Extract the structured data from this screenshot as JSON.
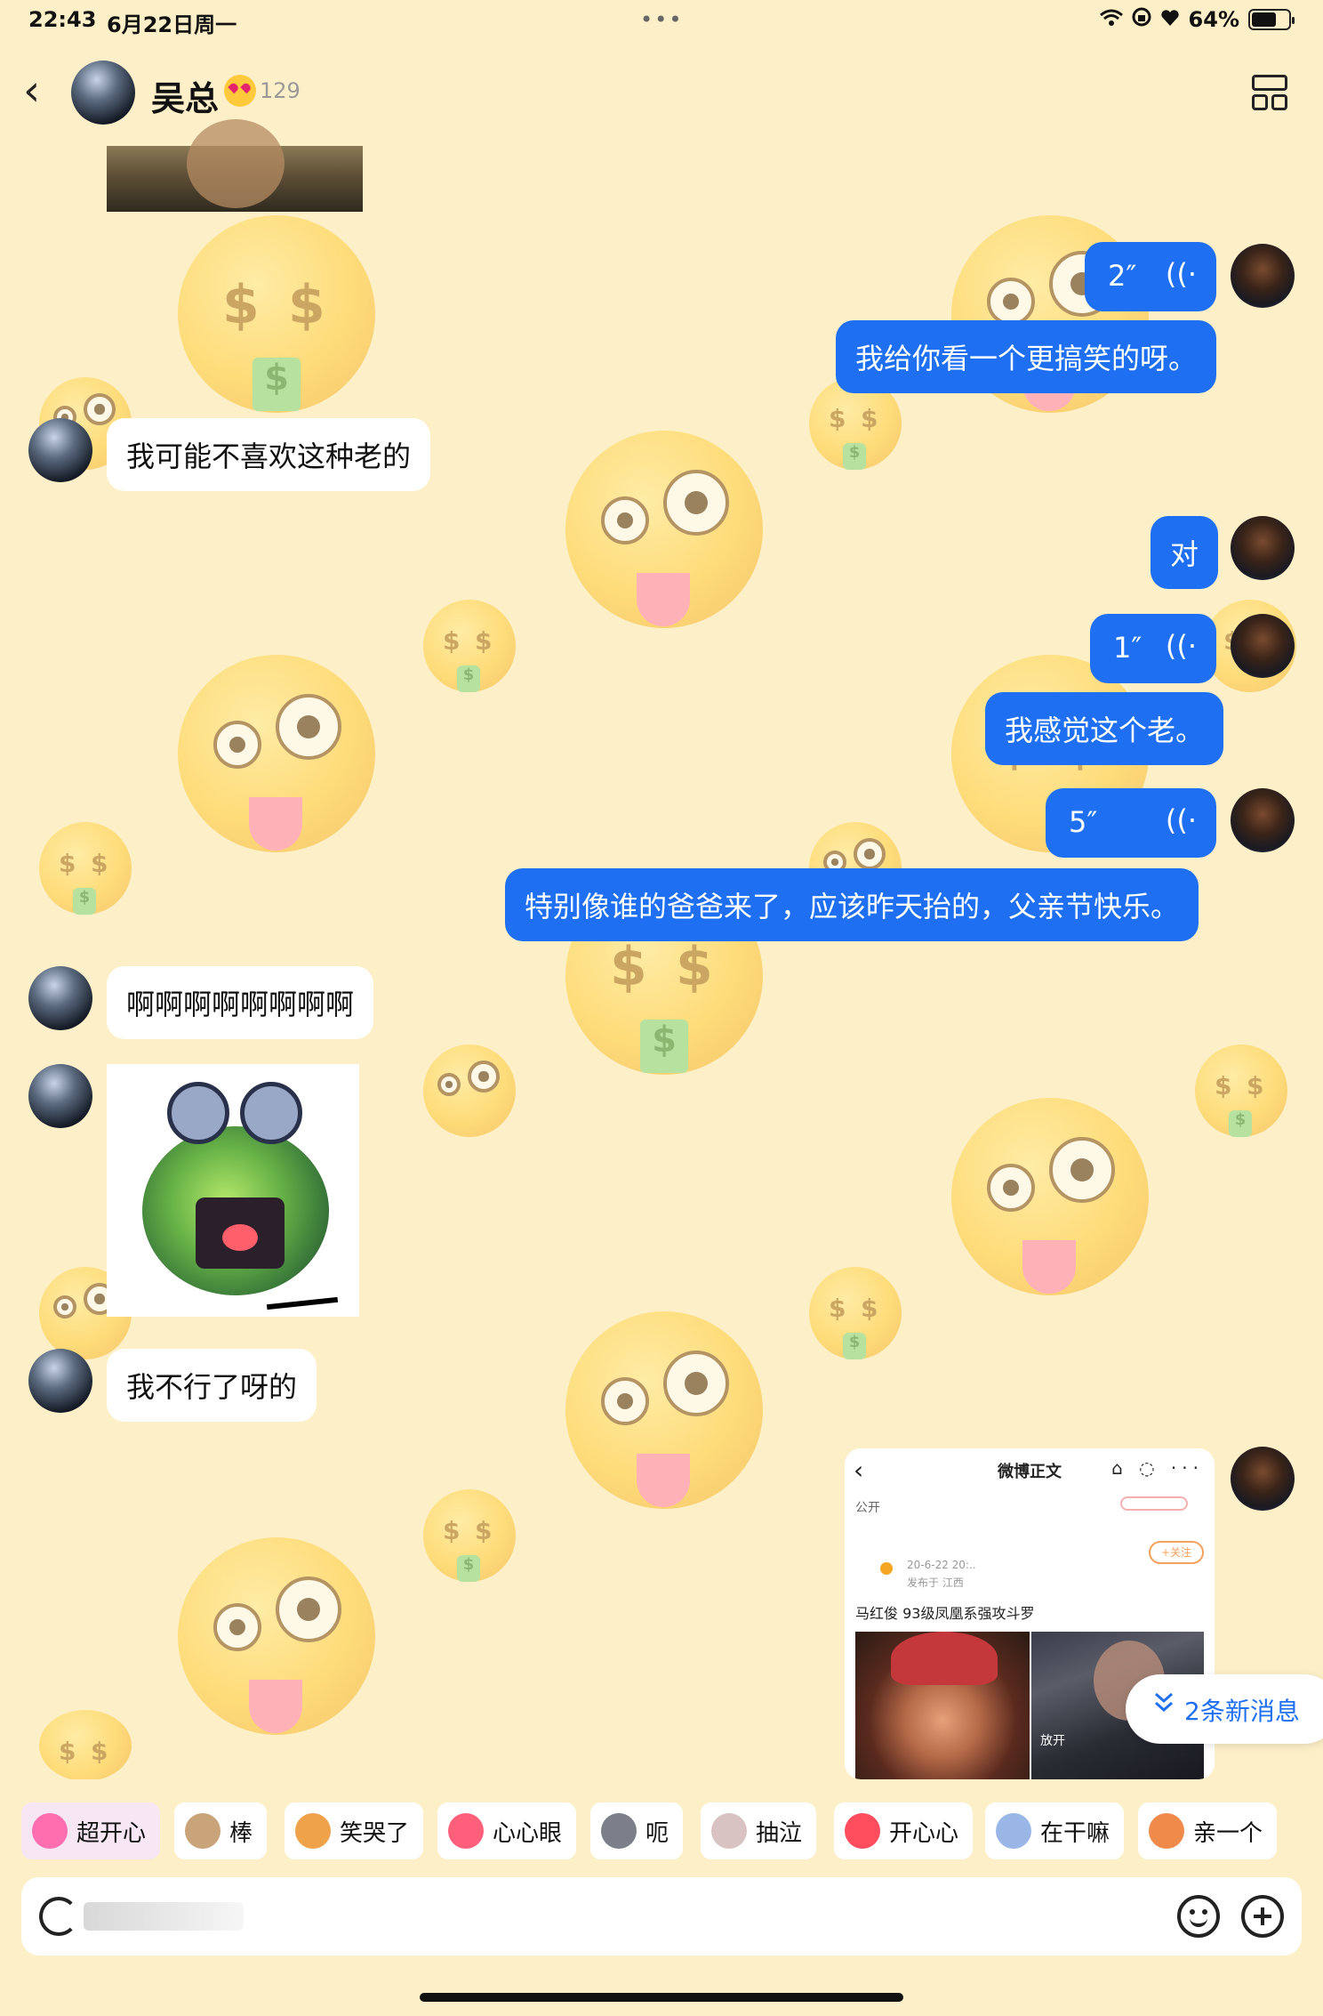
{
  "status_bar": {
    "time": "22:43",
    "date": "6月22日周一",
    "dots": "•••",
    "battery_text": "64%",
    "icons": [
      "wifi-icon",
      "lock-rotation-icon",
      "heart-icon",
      "battery-icon"
    ]
  },
  "header": {
    "back_icon": "chevron-left-icon",
    "contact_name": "吴总",
    "level_count": "129",
    "layout_icon": "layout-grid-icon"
  },
  "messages": {
    "voice_1": "2″",
    "out_1": "我给你看一个更搞笑的呀。",
    "in_1": "我可能不喜欢这种老的",
    "out_2": "对",
    "voice_2": "1″",
    "out_3": "我感觉这个老。",
    "voice_3": "5″",
    "out_4": "特别像谁的爸爸来了，应该昨天抬的，父亲节快乐。",
    "in_2": "啊啊啊啊啊啊啊啊",
    "in_3": "我不行了呀的"
  },
  "voice_wave_glyph": "((·",
  "weibo_card": {
    "back": "‹",
    "title": "微博正文",
    "tools": "⌂ ◌ ···",
    "visibility": "公开",
    "follow": "+关注",
    "date": "20-6-22 20:..",
    "location": "发布于 江西",
    "text": "马红俊 93级凤凰系强攻斗罗",
    "image_caption": "放开"
  },
  "new_messages": {
    "icon": "double-chevron-down-icon",
    "label": "2条新消息"
  },
  "quick_stickers": [
    {
      "label": "超开心",
      "color": "#ff6fb0"
    },
    {
      "label": "棒",
      "color": "#c9a37a"
    },
    {
      "label": "笑哭了",
      "color": "#f0a24a"
    },
    {
      "label": "心心眼",
      "color": "#ff5f7a"
    },
    {
      "label": "呃",
      "color": "#7a7f8a"
    },
    {
      "label": "抽泣",
      "color": "#d8c2c2"
    },
    {
      "label": "开心心",
      "color": "#ff4d5e"
    },
    {
      "label": "在干嘛",
      "color": "#9ab6e6"
    },
    {
      "label": "亲一个",
      "color": "#f08a4a"
    }
  ],
  "input": {
    "voice_icon": "voice-input-icon",
    "placeholder": "",
    "emoji_icon": "smile-icon",
    "plus_icon": "plus-circle-icon"
  },
  "colors": {
    "background": "#fdf0c8",
    "out_bubble": "#1f6ff2",
    "in_bubble": "#ffffff",
    "accent": "#1f6ff2"
  }
}
